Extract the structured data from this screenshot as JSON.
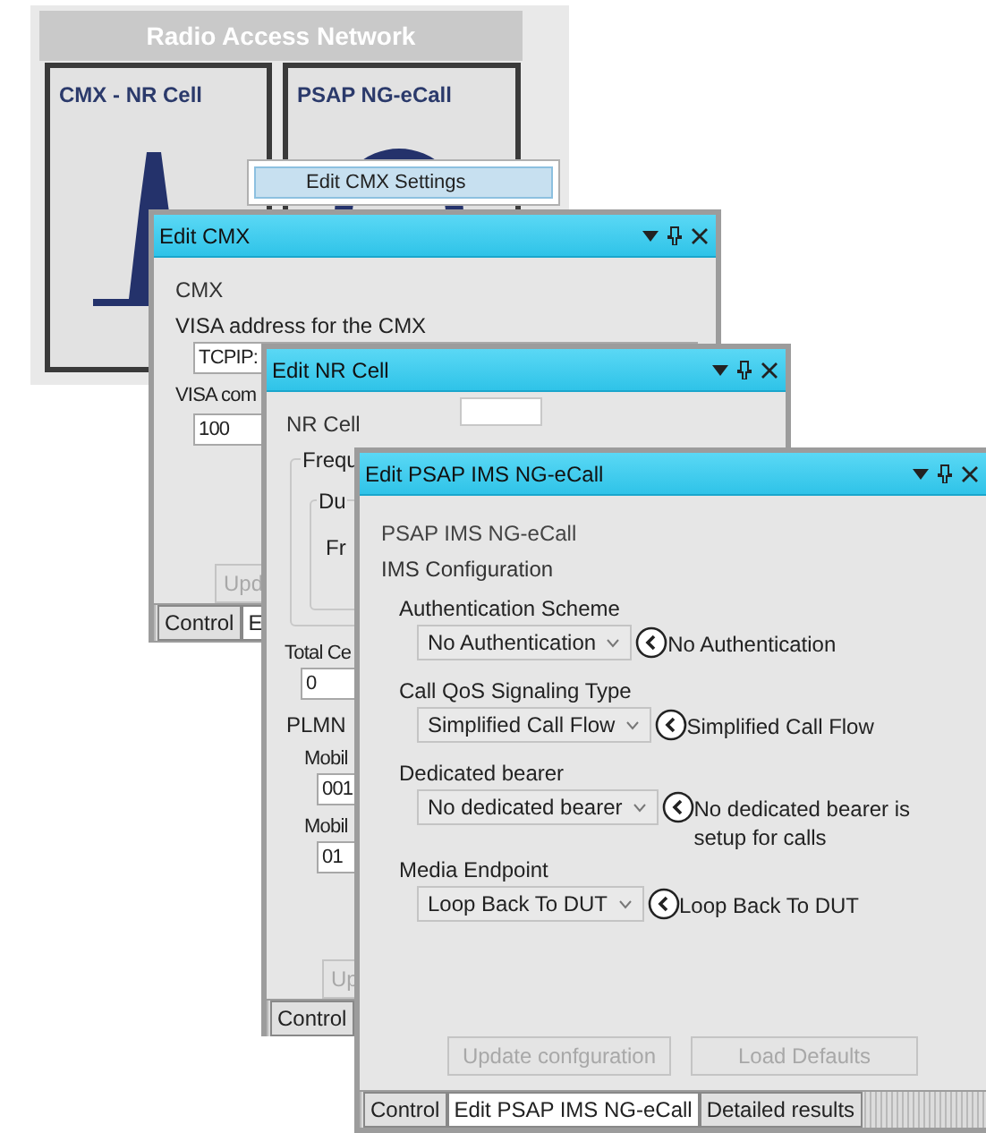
{
  "panel": {
    "title": "Radio Access Network",
    "cards": [
      {
        "title": "CMX - NR Cell",
        "kind": "tower"
      },
      {
        "title": "PSAP NG-eCall",
        "kind": "ring"
      }
    ]
  },
  "context_menu": {
    "items": [
      {
        "label": "Edit CMX Settings",
        "selected": true
      }
    ]
  },
  "edit_cmx": {
    "title": "Edit CMX",
    "heading": "CMX",
    "fields": [
      {
        "label": "VISA address for the CMX",
        "value": "TCPIP:"
      },
      {
        "label": "VISA com",
        "value": "100"
      }
    ],
    "button": {
      "label": "Upd",
      "disabled": true
    },
    "tabs": [
      {
        "label": "Control",
        "selected": false
      },
      {
        "label": "E",
        "selected": true
      }
    ]
  },
  "edit_nr_cell": {
    "title": "Edit NR Cell",
    "heading": "NR Cell",
    "frequency_group": {
      "label": "Frequ",
      "inner_group": {
        "label": "Du",
        "field_label": "Fr"
      }
    },
    "total_cells": {
      "label": "Total Ce",
      "value": "0"
    },
    "plmn": {
      "label": "PLMN",
      "fields": [
        {
          "label": "Mobil",
          "value": "001"
        },
        {
          "label": "Mobil",
          "value": "01"
        }
      ]
    },
    "button": {
      "label": "Up",
      "disabled": true
    },
    "tabs": [
      {
        "label": "Control",
        "selected": false
      }
    ]
  },
  "edit_psap": {
    "title": "Edit PSAP IMS NG-eCall",
    "heading": "PSAP IMS NG-eCall",
    "section": "IMS Configuration",
    "settings": [
      {
        "label": "Authentication Scheme",
        "value": "No Authentication",
        "description": "No Authentication"
      },
      {
        "label": "Call QoS Signaling Type",
        "value": "Simplified Call Flow",
        "description": "Simplified Call Flow"
      },
      {
        "label": "Dedicated bearer",
        "value": "No dedicated bearer",
        "description": "No dedicated bearer is setup for calls"
      },
      {
        "label": "Media Endpoint",
        "value": "Loop Back To DUT",
        "description": "Loop Back To DUT"
      }
    ],
    "buttons": [
      {
        "label": "Update confguration",
        "disabled": true
      },
      {
        "label": "Load Defaults",
        "disabled": true
      }
    ],
    "tabs": [
      {
        "label": "Control",
        "selected": false
      },
      {
        "label": "Edit PSAP IMS NG-eCall",
        "selected": true
      },
      {
        "label": "Detailed results",
        "selected": false
      }
    ]
  }
}
